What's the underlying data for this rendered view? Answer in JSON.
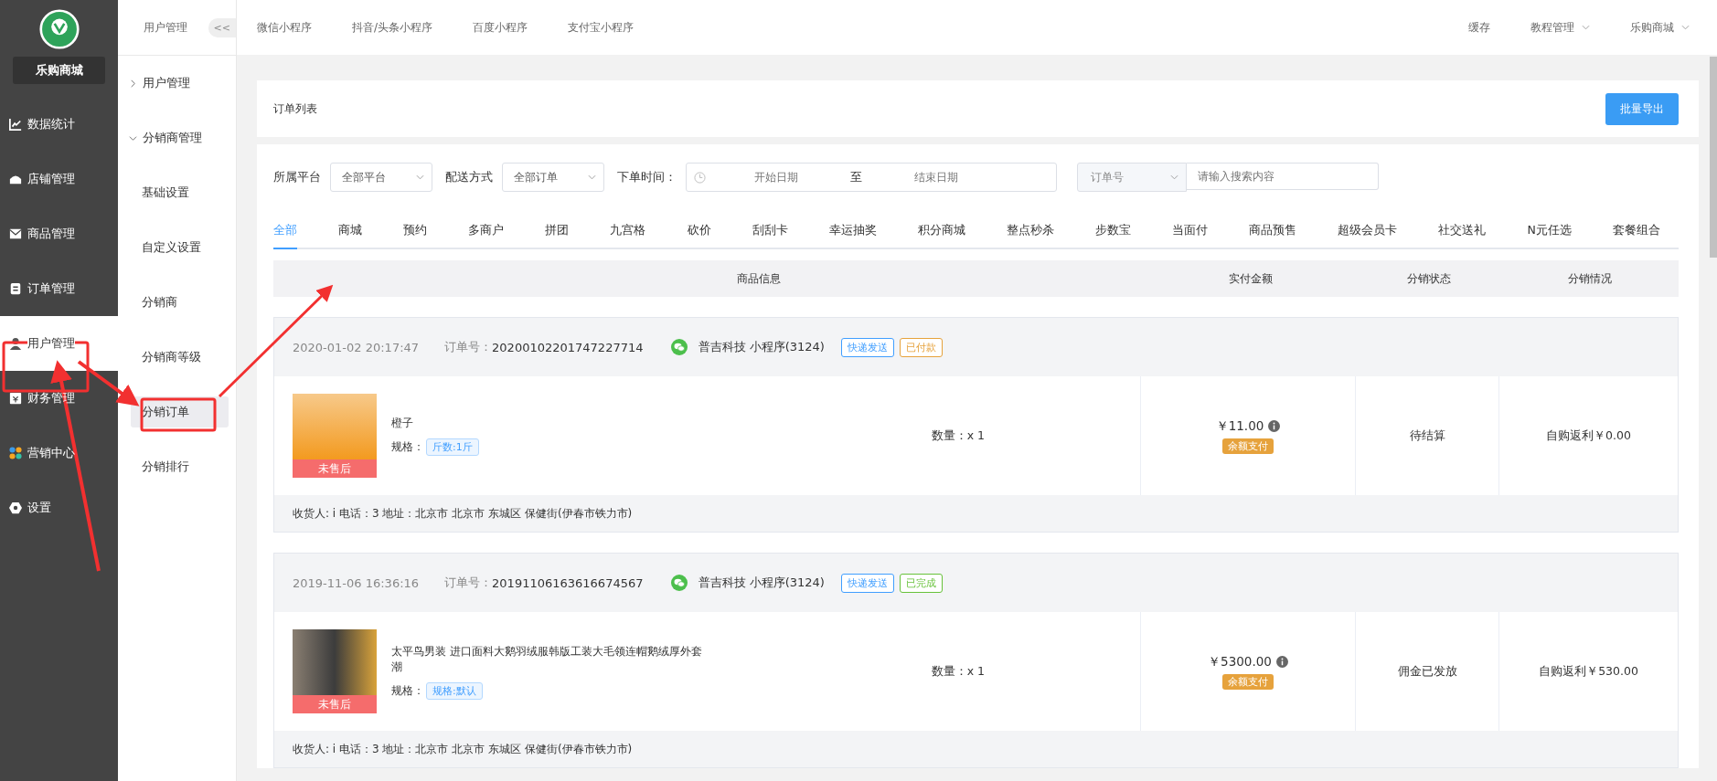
{
  "brand": {
    "name": "乐购商城"
  },
  "main_nav": [
    {
      "label": "数据统计",
      "selected": false
    },
    {
      "label": "店铺管理",
      "selected": false
    },
    {
      "label": "商品管理",
      "selected": false
    },
    {
      "label": "订单管理",
      "selected": false
    },
    {
      "label": "用户管理",
      "selected": true
    },
    {
      "label": "财务管理",
      "selected": false
    },
    {
      "label": "营销中心",
      "selected": false
    },
    {
      "label": "设置",
      "selected": false
    }
  ],
  "sub_nav": {
    "title": "用户管理",
    "collapse": "<<",
    "groups": [
      {
        "label": "用户管理",
        "expanded": false
      },
      {
        "label": "分销商管理",
        "expanded": true,
        "children": [
          {
            "label": "基础设置",
            "selected": false
          },
          {
            "label": "自定义设置",
            "selected": false
          },
          {
            "label": "分销商",
            "selected": false
          },
          {
            "label": "分销商等级",
            "selected": false
          },
          {
            "label": "分销订单",
            "selected": true
          },
          {
            "label": "分销排行",
            "selected": false
          }
        ]
      }
    ]
  },
  "top_tabs": [
    "微信小程序",
    "抖音/头条小程序",
    "百度小程序",
    "支付宝小程序"
  ],
  "top_right": [
    {
      "label": "缓存",
      "dropdown": false
    },
    {
      "label": "教程管理",
      "dropdown": true
    },
    {
      "label": "乐购商城",
      "dropdown": true
    }
  ],
  "page_title": "订单列表",
  "export_button": "批量导出",
  "filters": {
    "platform_label": "所属平台",
    "platform_value": "全部平台",
    "delivery_label": "配送方式",
    "delivery_value": "全部订单",
    "time_label": "下单时间：",
    "start_placeholder": "开始日期",
    "range_sep": "至",
    "end_placeholder": "结束日期",
    "search_type": "订单号",
    "search_placeholder": "请输入搜索内容"
  },
  "order_tabs": [
    {
      "label": "全部",
      "selected": true
    },
    {
      "label": "商城",
      "selected": false
    },
    {
      "label": "预约",
      "selected": false
    },
    {
      "label": "多商户",
      "selected": false
    },
    {
      "label": "拼团",
      "selected": false
    },
    {
      "label": "九宫格",
      "selected": false
    },
    {
      "label": "砍价",
      "selected": false
    },
    {
      "label": "刮刮卡",
      "selected": false
    },
    {
      "label": "幸运抽奖",
      "selected": false
    },
    {
      "label": "积分商城",
      "selected": false
    },
    {
      "label": "整点秒杀",
      "selected": false
    },
    {
      "label": "步数宝",
      "selected": false
    },
    {
      "label": "当面付",
      "selected": false
    },
    {
      "label": "商品预售",
      "selected": false
    },
    {
      "label": "超级会员卡",
      "selected": false
    },
    {
      "label": "社交送礼",
      "selected": false
    },
    {
      "label": "N元任选",
      "selected": false
    },
    {
      "label": "套餐组合",
      "selected": false
    }
  ],
  "table": {
    "columns": [
      "商品信息",
      "实付金额",
      "分销状态",
      "分销情况"
    ]
  },
  "orders": [
    {
      "time": "2020-01-02 20:17:47",
      "order_no_label": "订单号：",
      "order_no": "20200102201747227714",
      "store": "普吉科技 小程序(3124)",
      "tags": [
        {
          "label": "快递发送",
          "color": "#409eff"
        },
        {
          "label": "已付款",
          "color": "#e6a23c"
        }
      ],
      "product": "橙子",
      "spec_label": "规格：",
      "spec": "斤数:1斤",
      "after_sale": "未售后",
      "quantity": "数量：x 1",
      "amount": "￥11.00",
      "pay_method": "余额支付",
      "status": "待结算",
      "commission": "自购返利￥0.00",
      "address": "收货人: i 电话：3 地址：北京市 北京市 东城区 保健街(伊春市铁力市)"
    },
    {
      "time": "2019-11-06 16:36:16",
      "order_no_label": "订单号：",
      "order_no": "20191106163616674567",
      "store": "普吉科技 小程序(3124)",
      "tags": [
        {
          "label": "快递发送",
          "color": "#409eff"
        },
        {
          "label": "已完成",
          "color": "#67c23a"
        }
      ],
      "product": "太平鸟男装 进口面料大鹅羽绒服韩版工装大毛领连帽鹅绒厚外套潮",
      "spec_label": "规格：",
      "spec": "规格:默认",
      "after_sale": "未售后",
      "quantity": "数量：x 1",
      "amount": "￥5300.00",
      "pay_method": "余额支付",
      "status": "佣金已发放",
      "commission": "自购返利￥530.00",
      "address": "收货人: i 电话：3 地址：北京市 北京市 东城区 保健街(伊春市铁力市)"
    }
  ]
}
